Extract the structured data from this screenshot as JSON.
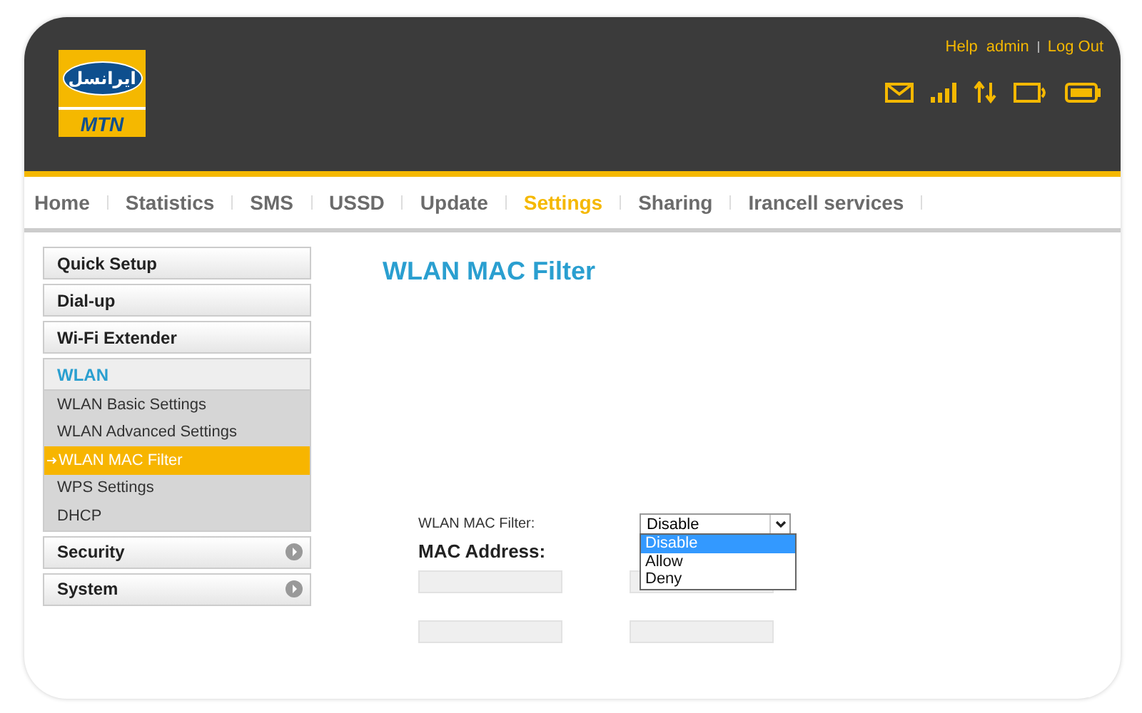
{
  "logo": {
    "script": "ایرانسل",
    "mark": "MTN"
  },
  "top_links": [
    "Help",
    "admin",
    "Log Out"
  ],
  "nav": [
    {
      "label": "Home",
      "selected": false
    },
    {
      "label": "Statistics",
      "selected": false
    },
    {
      "label": "SMS",
      "selected": false
    },
    {
      "label": "USSD",
      "selected": false
    },
    {
      "label": "Update",
      "selected": false
    },
    {
      "label": "Settings",
      "selected": true
    },
    {
      "label": "Sharing",
      "selected": false
    },
    {
      "label": "Irancell services",
      "selected": false
    }
  ],
  "sidebar": [
    {
      "label": "Quick Setup",
      "kind": "link"
    },
    {
      "label": "Dial-up",
      "kind": "link"
    },
    {
      "label": "Wi-Fi Extender",
      "kind": "link"
    },
    {
      "label": "WLAN",
      "kind": "group",
      "expanded": true,
      "children": [
        {
          "label": "WLAN Basic Settings",
          "selected": false
        },
        {
          "label": "WLAN Advanced Settings",
          "selected": false
        },
        {
          "label": "WLAN MAC Filter",
          "selected": true
        },
        {
          "label": "WPS Settings",
          "selected": false
        },
        {
          "label": "DHCP",
          "selected": false
        }
      ]
    },
    {
      "label": "Security",
      "kind": "group",
      "expanded": false
    },
    {
      "label": "System",
      "kind": "group",
      "expanded": false
    }
  ],
  "content": {
    "title": "WLAN MAC Filter",
    "filter_label": "WLAN MAC Filter:",
    "filter_value": "Disable",
    "options": [
      {
        "label": "Disable",
        "selected": true
      },
      {
        "label": "Allow",
        "selected": false
      },
      {
        "label": "Deny",
        "selected": false
      }
    ],
    "mac_heading": "MAC Address:"
  }
}
